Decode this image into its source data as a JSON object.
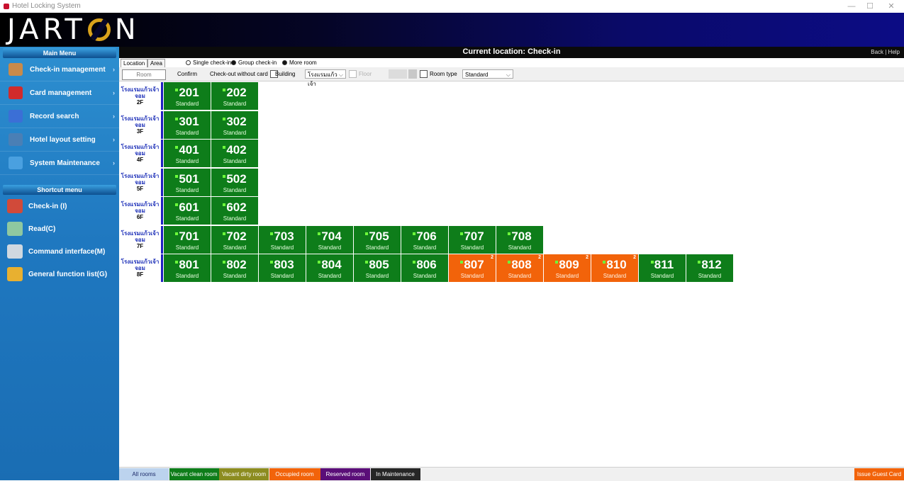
{
  "window": {
    "title": "Hotel Locking System",
    "minimize": "—",
    "maximize": "☐",
    "close": "✕"
  },
  "logo": {
    "left": "JART",
    "right": "N"
  },
  "sidebar": {
    "main_menu_label": "Main Menu",
    "items": [
      {
        "label": "Check-in management",
        "icon": "door-icon",
        "color": "#c98a4a"
      },
      {
        "label": "Card management",
        "icon": "card-icon",
        "color": "#d12b2b"
      },
      {
        "label": "Record search",
        "icon": "magnifier-icon",
        "color": "#3b6fd6"
      },
      {
        "label": "Hotel layout setting",
        "icon": "building-icon",
        "color": "#4a7fb5"
      },
      {
        "label": "System Maintenance",
        "icon": "wrench-icon",
        "color": "#4aa0e0"
      }
    ],
    "shortcut_label": "Shortcut menu",
    "shortcuts": [
      {
        "label": "Check-in (I)",
        "icon": "hand-card-icon",
        "color": "#d14a3a"
      },
      {
        "label": "Read(C)",
        "icon": "reader-icon",
        "color": "#8fc8a0"
      },
      {
        "label": "Command interface(M)",
        "icon": "eraser-icon",
        "color": "#cfd8e0"
      },
      {
        "label": "General function list(G)",
        "icon": "grid-icon",
        "color": "#e8b030"
      }
    ]
  },
  "location_bar": {
    "text": "Current location:  Check-in",
    "links": "Back  |  Help"
  },
  "tabs": {
    "location": "Location",
    "area": "Area"
  },
  "radios": [
    {
      "label": "Single check-in",
      "selected": false
    },
    {
      "label": "Group check-in",
      "selected": true
    },
    {
      "label": "More room",
      "selected": true
    }
  ],
  "toolbar": {
    "room_placeholder": "Room",
    "confirm": "Confirm",
    "checkout_without_card": "Check-out without card",
    "building": "Building",
    "building_value": "โรงแรมแก้วเจ้า",
    "floor": "Floor",
    "room_type": "Room type",
    "room_type_value": "Standard"
  },
  "floors": [
    {
      "building": "โรงแรมแก้วเจ้า",
      "building2": "จอม",
      "floor": "2F",
      "rooms": [
        {
          "num": "201",
          "type": "Standard",
          "status": "vacant"
        },
        {
          "num": "202",
          "type": "Standard",
          "status": "vacant"
        }
      ]
    },
    {
      "building": "โรงแรมแก้วเจ้า",
      "building2": "จอม",
      "floor": "3F",
      "rooms": [
        {
          "num": "301",
          "type": "Standard",
          "status": "vacant"
        },
        {
          "num": "302",
          "type": "Standard",
          "status": "vacant"
        }
      ]
    },
    {
      "building": "โรงแรมแก้วเจ้า",
      "building2": "จอม",
      "floor": "4F",
      "rooms": [
        {
          "num": "401",
          "type": "Standard",
          "status": "vacant"
        },
        {
          "num": "402",
          "type": "Standard",
          "status": "vacant"
        }
      ]
    },
    {
      "building": "โรงแรมแก้วเจ้า",
      "building2": "จอม",
      "floor": "5F",
      "rooms": [
        {
          "num": "501",
          "type": "Standard",
          "status": "vacant"
        },
        {
          "num": "502",
          "type": "Standard",
          "status": "vacant"
        }
      ]
    },
    {
      "building": "โรงแรมแก้วเจ้า",
      "building2": "จอม",
      "floor": "6F",
      "rooms": [
        {
          "num": "601",
          "type": "Standard",
          "status": "vacant"
        },
        {
          "num": "602",
          "type": "Standard",
          "status": "vacant"
        }
      ]
    },
    {
      "building": "โรงแรมแก้วเจ้า",
      "building2": "จอม",
      "floor": "7F",
      "rooms": [
        {
          "num": "701",
          "type": "Standard",
          "status": "vacant"
        },
        {
          "num": "702",
          "type": "Standard",
          "status": "vacant"
        },
        {
          "num": "703",
          "type": "Standard",
          "status": "vacant"
        },
        {
          "num": "704",
          "type": "Standard",
          "status": "vacant"
        },
        {
          "num": "705",
          "type": "Standard",
          "status": "vacant"
        },
        {
          "num": "706",
          "type": "Standard",
          "status": "vacant"
        },
        {
          "num": "707",
          "type": "Standard",
          "status": "vacant"
        },
        {
          "num": "708",
          "type": "Standard",
          "status": "vacant"
        }
      ]
    },
    {
      "building": "โรงแรมแก้วเจ้า",
      "building2": "จอม",
      "floor": "8F",
      "rooms": [
        {
          "num": "801",
          "type": "Standard",
          "status": "vacant"
        },
        {
          "num": "802",
          "type": "Standard",
          "status": "vacant"
        },
        {
          "num": "803",
          "type": "Standard",
          "status": "vacant"
        },
        {
          "num": "804",
          "type": "Standard",
          "status": "vacant"
        },
        {
          "num": "805",
          "type": "Standard",
          "status": "vacant"
        },
        {
          "num": "806",
          "type": "Standard",
          "status": "vacant"
        },
        {
          "num": "807",
          "type": "Standard",
          "status": "occupied",
          "count": "2"
        },
        {
          "num": "808",
          "type": "Standard",
          "status": "occupied",
          "count": "2"
        },
        {
          "num": "809",
          "type": "Standard",
          "status": "occupied",
          "count": "2"
        },
        {
          "num": "810",
          "type": "Standard",
          "status": "occupied",
          "count": "2"
        },
        {
          "num": "811",
          "type": "Standard",
          "status": "vacant"
        },
        {
          "num": "812",
          "type": "Standard",
          "status": "vacant"
        }
      ]
    }
  ],
  "legend": [
    {
      "label": "All rooms",
      "bg": "#bcd3ee",
      "fg": "#1c2a6a"
    },
    {
      "label": "Vacant clean room",
      "bg": "#0e7d1a",
      "fg": "#ffffff"
    },
    {
      "label": "Vacant dirty room",
      "bg": "#8c8c20",
      "fg": "#ffffff"
    },
    {
      "label": "Occupied room",
      "bg": "#f2630a",
      "fg": "#ffffff"
    },
    {
      "label": "Reserved room",
      "bg": "#5a0e78",
      "fg": "#ffffff"
    },
    {
      "label": "In Maintenance",
      "bg": "#262626",
      "fg": "#ffffff"
    }
  ],
  "issue_button": "Issue Guest Card"
}
